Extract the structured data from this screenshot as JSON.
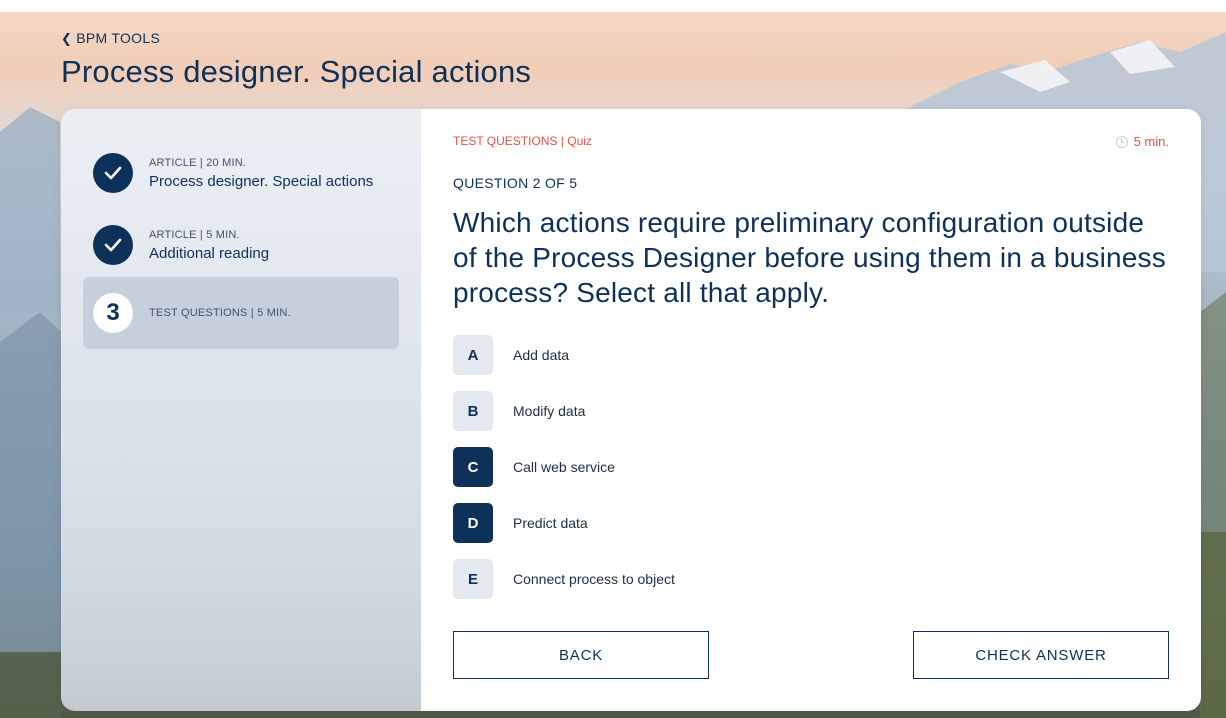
{
  "header": {
    "back_label": "BPM TOOLS",
    "title": "Process designer. Special actions"
  },
  "sidebar": {
    "steps": [
      {
        "meta": "ARTICLE | 20 MIN.",
        "name": "Process designer. Special actions",
        "status": "completed"
      },
      {
        "meta": "ARTICLE | 5 MIN.",
        "name": "Additional reading",
        "status": "completed"
      },
      {
        "meta": "TEST QUESTIONS | 5 MIN.",
        "name": "",
        "number": "3",
        "status": "current"
      }
    ]
  },
  "quiz": {
    "label": "TEST QUESTIONS | Quiz",
    "duration": "5 min.",
    "counter": "QUESTION 2 OF 5",
    "question": "Which actions require preliminary configuration outside of the Process Designer before using them in a business process? Select all that apply.",
    "options": [
      {
        "letter": "A",
        "label": "Add data",
        "selected": false
      },
      {
        "letter": "B",
        "label": "Modify data",
        "selected": false
      },
      {
        "letter": "C",
        "label": "Call web service",
        "selected": true
      },
      {
        "letter": "D",
        "label": "Predict data",
        "selected": true
      },
      {
        "letter": "E",
        "label": "Connect process to object",
        "selected": false
      }
    ],
    "back_label": "BACK",
    "check_label": "CHECK ANSWER"
  },
  "colors": {
    "primary": "#0d3158",
    "accent": "#e5533d",
    "option_bg": "#e4e9ef"
  }
}
